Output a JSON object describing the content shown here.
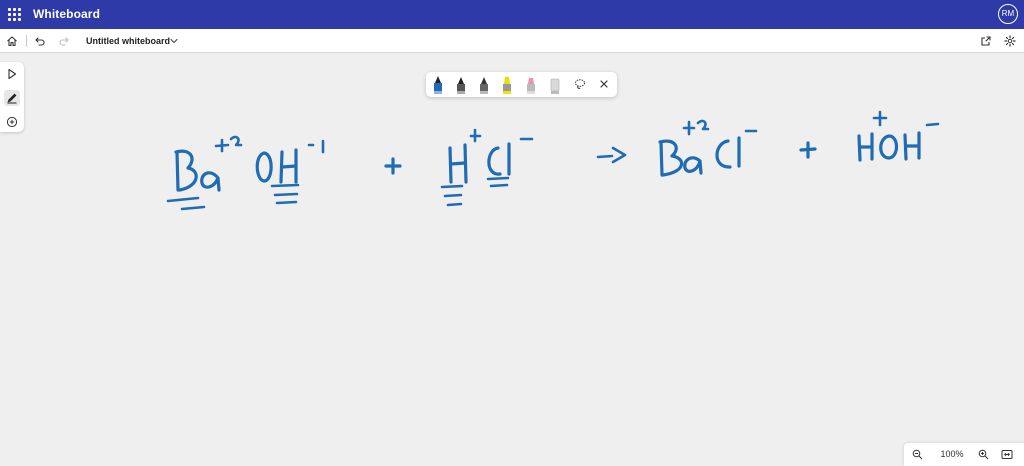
{
  "app": {
    "title": "Whiteboard",
    "user_initials": "RM"
  },
  "toolbar": {
    "doc_title": "Untitled whiteboard"
  },
  "zoom": {
    "level": "100%"
  },
  "ink": {
    "color": "#1f6bb4"
  },
  "pens": [
    {
      "name": "blue-pen",
      "color": "#1f6bb4"
    },
    {
      "name": "black-pen",
      "color": "#333333"
    },
    {
      "name": "dark-pen",
      "color": "#444444"
    },
    {
      "name": "yellow-highlighter",
      "color": "#f2e600"
    },
    {
      "name": "pink-highlighter",
      "color": "#f08fae"
    },
    {
      "name": "eraser",
      "color": "#d0d0d0"
    }
  ]
}
